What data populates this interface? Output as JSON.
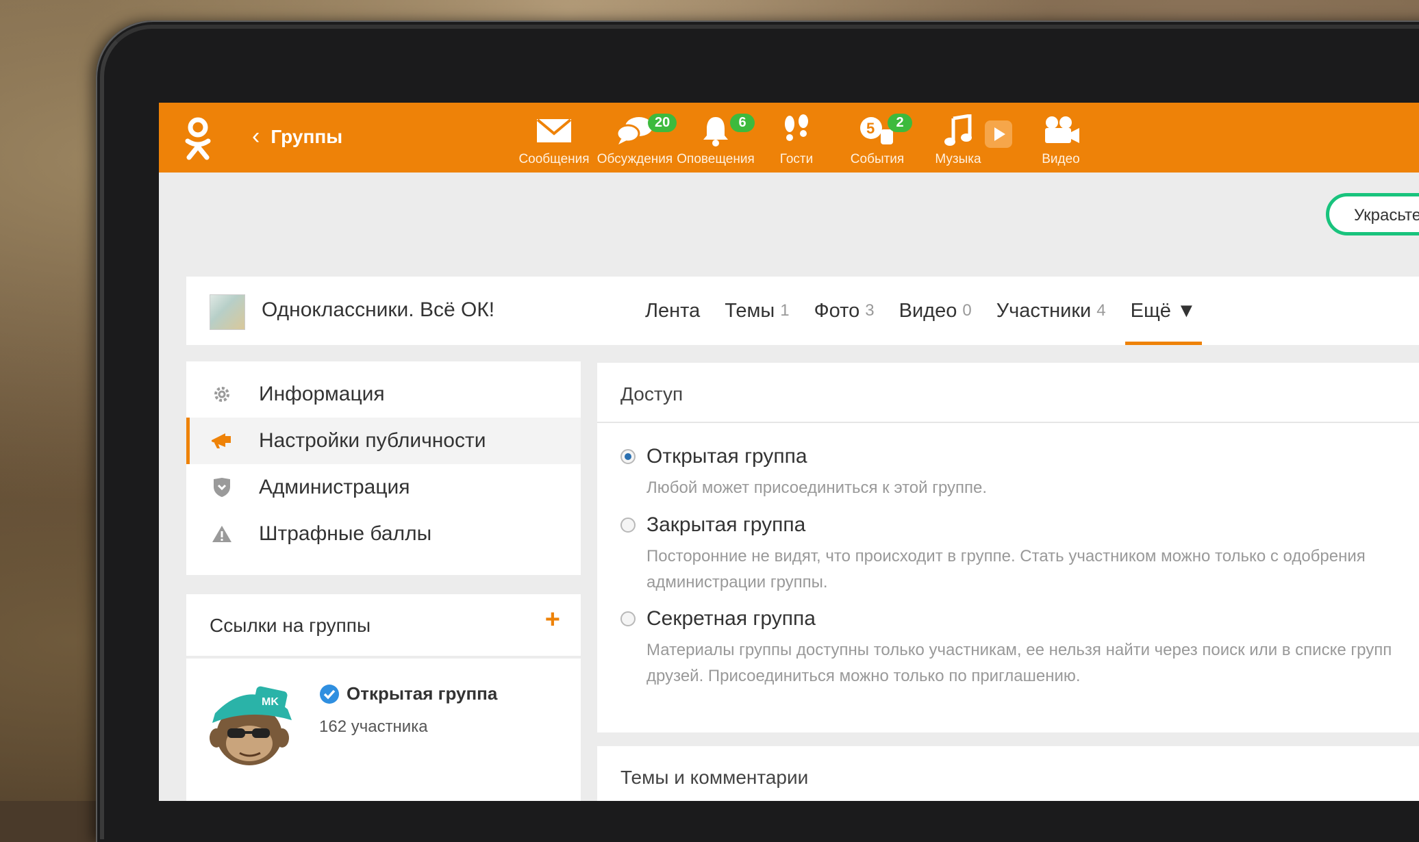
{
  "topbar": {
    "back_label": "Группы",
    "nav": [
      {
        "label": "Сообщения",
        "icon": "envelope-icon"
      },
      {
        "label": "Обсуждения",
        "icon": "chat-bubbles-icon",
        "badge": "20"
      },
      {
        "label": "Оповещения",
        "icon": "bell-icon",
        "badge": "6"
      },
      {
        "label": "Гости",
        "icon": "footprints-icon"
      },
      {
        "label": "События",
        "icon": "events-icon",
        "badge": "2"
      },
      {
        "label": "Музыка",
        "icon": "music-note-icon"
      },
      {
        "label": "Видео",
        "icon": "video-camera-icon"
      }
    ],
    "decorate_label": "Украсьте"
  },
  "group": {
    "name": "Одноклассники. Всё ОК!",
    "tabs": [
      {
        "label": "Лента",
        "count": ""
      },
      {
        "label": "Темы",
        "count": "1"
      },
      {
        "label": "Фото",
        "count": "3"
      },
      {
        "label": "Видео",
        "count": "0"
      },
      {
        "label": "Участники",
        "count": "4"
      },
      {
        "label": "Ещё ▼",
        "count": ""
      }
    ]
  },
  "menu": {
    "items": [
      {
        "label": "Информация",
        "icon": "gear-icon"
      },
      {
        "label": "Настройки публичности",
        "icon": "megaphone-icon"
      },
      {
        "label": "Администрация",
        "icon": "shield-icon"
      },
      {
        "label": "Штрафные баллы",
        "icon": "warning-icon"
      }
    ]
  },
  "links": {
    "title": "Ссылки на группы",
    "plus": "+",
    "card": {
      "name": "Открытая группа",
      "members": "162 участника"
    }
  },
  "access": {
    "title": "Доступ",
    "options": [
      {
        "label": "Открытая группа",
        "desc": "Любой может присоединиться к этой группе."
      },
      {
        "label": "Закрытая группа",
        "desc": "Посторонние не видят, что происходит в группе. Стать участником можно только с одобрения администрации группы."
      },
      {
        "label": "Секретная группа",
        "desc": "Материалы группы доступны только участникам, ее нельзя найти через поиск или в списке групп друзей. Присоединиться можно только по приглашению."
      }
    ]
  },
  "topics": {
    "title": "Темы и комментарии"
  },
  "colors": {
    "accent": "#ee8208",
    "badge": "#3dba3d",
    "decorate_border": "#19c37d"
  }
}
